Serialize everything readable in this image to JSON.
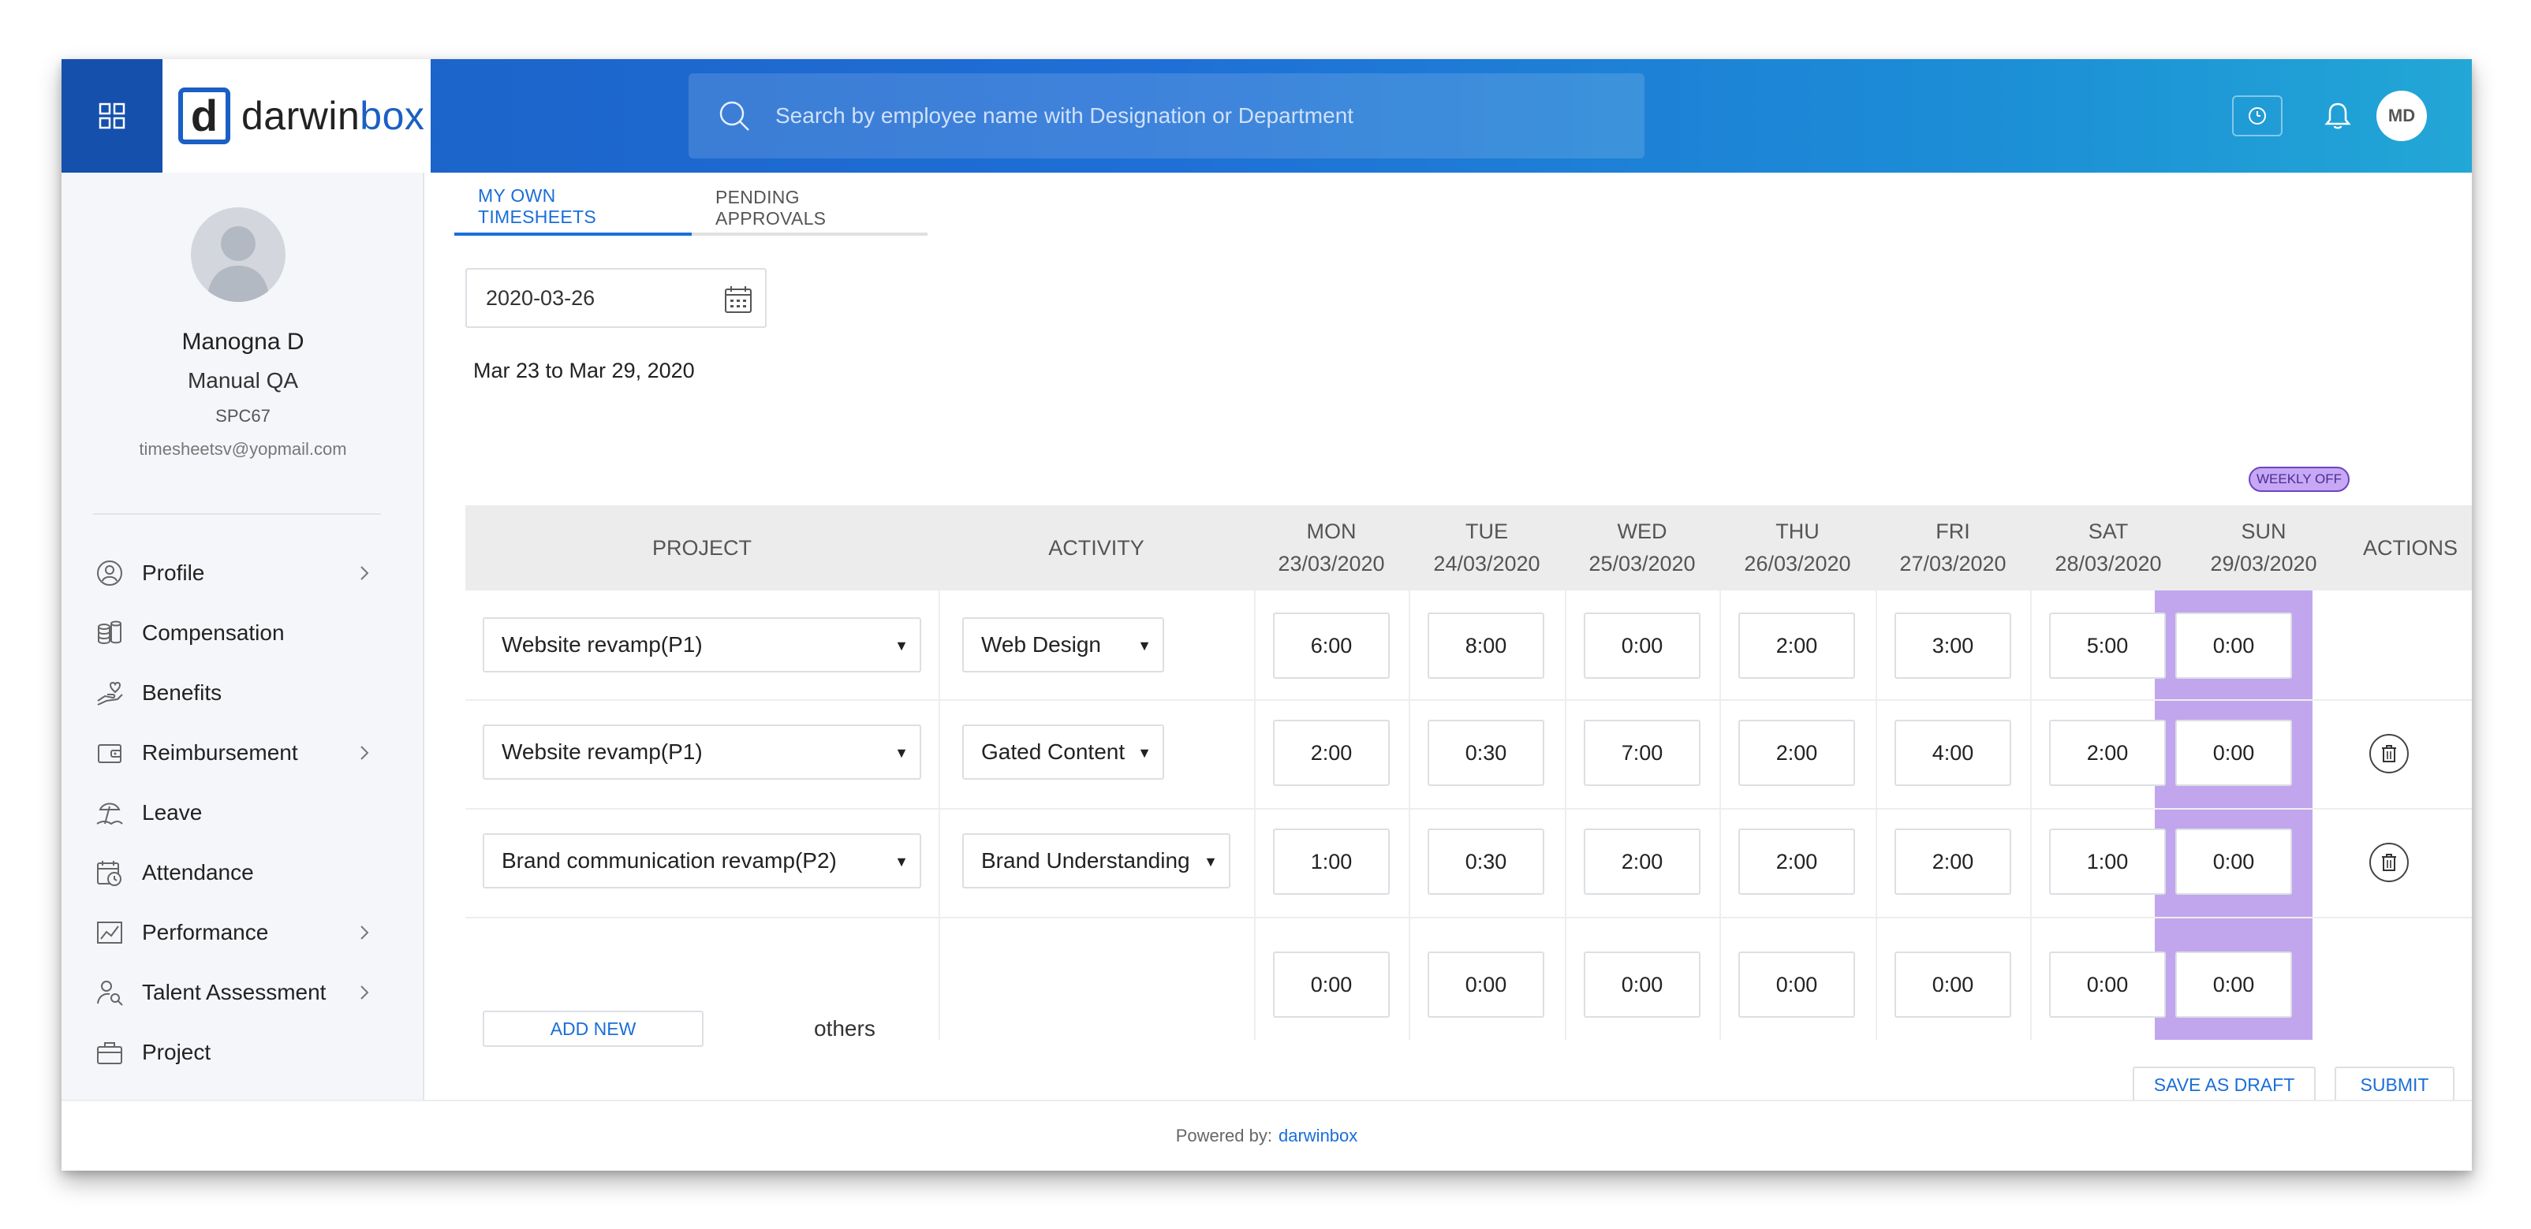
{
  "header": {
    "logo_letter": "d",
    "logo_text_a": "darwin",
    "logo_text_b": "box",
    "search_placeholder": "Search by employee name with Designation or Department",
    "avatar_initials": "MD"
  },
  "profile": {
    "name": "Manogna D",
    "role": "Manual QA",
    "code": "SPC67",
    "email": "timesheetsv@yopmail.com"
  },
  "nav": [
    {
      "label": "Profile",
      "icon": "user-circle-icon",
      "has_chevron": true
    },
    {
      "label": "Compensation",
      "icon": "coins-icon",
      "has_chevron": false
    },
    {
      "label": "Benefits",
      "icon": "hand-heart-icon",
      "has_chevron": false
    },
    {
      "label": "Reimbursement",
      "icon": "wallet-icon",
      "has_chevron": true
    },
    {
      "label": "Leave",
      "icon": "beach-icon",
      "has_chevron": false
    },
    {
      "label": "Attendance",
      "icon": "calendar-clock-icon",
      "has_chevron": false
    },
    {
      "label": "Performance",
      "icon": "chart-line-icon",
      "has_chevron": true
    },
    {
      "label": "Talent Assessment",
      "icon": "user-search-icon",
      "has_chevron": true
    },
    {
      "label": "Project",
      "icon": "briefcase-icon",
      "has_chevron": false
    }
  ],
  "tabs": [
    {
      "label": "MY OWN TIMESHEETS",
      "active": true
    },
    {
      "label": "PENDING APPROVALS",
      "active": false
    }
  ],
  "date_value": "2020-03-26",
  "range_text": "Mar 23 to Mar 29, 2020",
  "weekly_off_badge": "WEEKLY OFF",
  "table": {
    "headers": {
      "project": "PROJECT",
      "activity": "ACTIVITY",
      "actions": "ACTIONS"
    },
    "days": [
      {
        "day": "MON",
        "date": "23/03/2020"
      },
      {
        "day": "TUE",
        "date": "24/03/2020"
      },
      {
        "day": "WED",
        "date": "25/03/2020"
      },
      {
        "day": "THU",
        "date": "26/03/2020"
      },
      {
        "day": "FRI",
        "date": "27/03/2020"
      },
      {
        "day": "SAT",
        "date": "28/03/2020"
      },
      {
        "day": "SUN",
        "date": "29/03/2020"
      }
    ],
    "rows": [
      {
        "project": "Website revamp(P1)",
        "activity": "Web Design",
        "hours": [
          "6:00",
          "8:00",
          "0:00",
          "2:00",
          "3:00",
          "5:00",
          "0:00"
        ],
        "deletable": false
      },
      {
        "project": "Website revamp(P1)",
        "activity": "Gated Content",
        "hours": [
          "2:00",
          "0:30",
          "7:00",
          "2:00",
          "4:00",
          "2:00",
          "0:00"
        ],
        "deletable": true
      },
      {
        "project": "Brand communication revamp(P2)",
        "activity": "Brand Understanding",
        "hours": [
          "1:00",
          "0:30",
          "2:00",
          "2:00",
          "2:00",
          "1:00",
          "0:00"
        ],
        "deletable": true
      }
    ],
    "others": {
      "add_label": "ADD NEW",
      "label": "others",
      "hours": [
        "0:00",
        "0:00",
        "0:00",
        "0:00",
        "0:00",
        "0:00",
        "0:00"
      ]
    }
  },
  "buttons": {
    "save_draft": "SAVE AS DRAFT",
    "submit": "SUBMIT"
  },
  "footer": {
    "prefix": "Powered by:",
    "brand": "darwinbox"
  },
  "colors": {
    "header_start": "#1a5fc4",
    "header_end": "#22a7d6",
    "accent": "#1a6ed8",
    "weekly_off": "#c1a6ee"
  }
}
